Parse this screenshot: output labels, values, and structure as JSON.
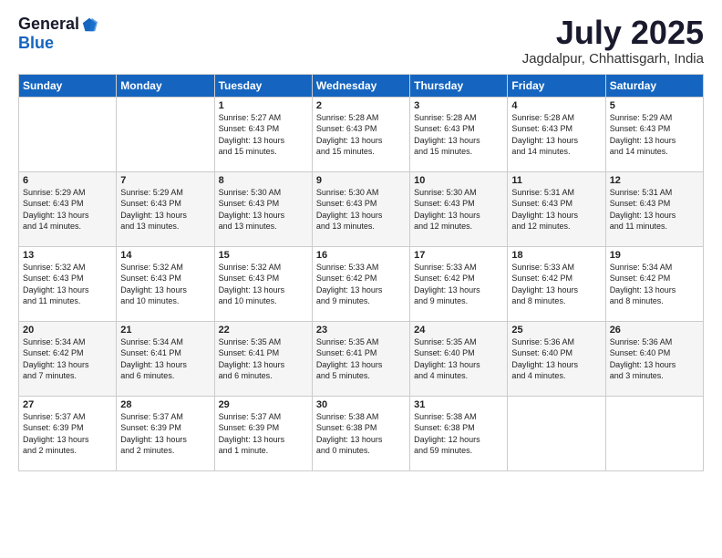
{
  "logo": {
    "general": "General",
    "blue": "Blue"
  },
  "title": "July 2025",
  "location": "Jagdalpur, Chhattisgarh, India",
  "days_of_week": [
    "Sunday",
    "Monday",
    "Tuesday",
    "Wednesday",
    "Thursday",
    "Friday",
    "Saturday"
  ],
  "weeks": [
    [
      {
        "day": "",
        "info": ""
      },
      {
        "day": "",
        "info": ""
      },
      {
        "day": "1",
        "info": "Sunrise: 5:27 AM\nSunset: 6:43 PM\nDaylight: 13 hours\nand 15 minutes."
      },
      {
        "day": "2",
        "info": "Sunrise: 5:28 AM\nSunset: 6:43 PM\nDaylight: 13 hours\nand 15 minutes."
      },
      {
        "day": "3",
        "info": "Sunrise: 5:28 AM\nSunset: 6:43 PM\nDaylight: 13 hours\nand 15 minutes."
      },
      {
        "day": "4",
        "info": "Sunrise: 5:28 AM\nSunset: 6:43 PM\nDaylight: 13 hours\nand 14 minutes."
      },
      {
        "day": "5",
        "info": "Sunrise: 5:29 AM\nSunset: 6:43 PM\nDaylight: 13 hours\nand 14 minutes."
      }
    ],
    [
      {
        "day": "6",
        "info": "Sunrise: 5:29 AM\nSunset: 6:43 PM\nDaylight: 13 hours\nand 14 minutes."
      },
      {
        "day": "7",
        "info": "Sunrise: 5:29 AM\nSunset: 6:43 PM\nDaylight: 13 hours\nand 13 minutes."
      },
      {
        "day": "8",
        "info": "Sunrise: 5:30 AM\nSunset: 6:43 PM\nDaylight: 13 hours\nand 13 minutes."
      },
      {
        "day": "9",
        "info": "Sunrise: 5:30 AM\nSunset: 6:43 PM\nDaylight: 13 hours\nand 13 minutes."
      },
      {
        "day": "10",
        "info": "Sunrise: 5:30 AM\nSunset: 6:43 PM\nDaylight: 13 hours\nand 12 minutes."
      },
      {
        "day": "11",
        "info": "Sunrise: 5:31 AM\nSunset: 6:43 PM\nDaylight: 13 hours\nand 12 minutes."
      },
      {
        "day": "12",
        "info": "Sunrise: 5:31 AM\nSunset: 6:43 PM\nDaylight: 13 hours\nand 11 minutes."
      }
    ],
    [
      {
        "day": "13",
        "info": "Sunrise: 5:32 AM\nSunset: 6:43 PM\nDaylight: 13 hours\nand 11 minutes."
      },
      {
        "day": "14",
        "info": "Sunrise: 5:32 AM\nSunset: 6:43 PM\nDaylight: 13 hours\nand 10 minutes."
      },
      {
        "day": "15",
        "info": "Sunrise: 5:32 AM\nSunset: 6:43 PM\nDaylight: 13 hours\nand 10 minutes."
      },
      {
        "day": "16",
        "info": "Sunrise: 5:33 AM\nSunset: 6:42 PM\nDaylight: 13 hours\nand 9 minutes."
      },
      {
        "day": "17",
        "info": "Sunrise: 5:33 AM\nSunset: 6:42 PM\nDaylight: 13 hours\nand 9 minutes."
      },
      {
        "day": "18",
        "info": "Sunrise: 5:33 AM\nSunset: 6:42 PM\nDaylight: 13 hours\nand 8 minutes."
      },
      {
        "day": "19",
        "info": "Sunrise: 5:34 AM\nSunset: 6:42 PM\nDaylight: 13 hours\nand 8 minutes."
      }
    ],
    [
      {
        "day": "20",
        "info": "Sunrise: 5:34 AM\nSunset: 6:42 PM\nDaylight: 13 hours\nand 7 minutes."
      },
      {
        "day": "21",
        "info": "Sunrise: 5:34 AM\nSunset: 6:41 PM\nDaylight: 13 hours\nand 6 minutes."
      },
      {
        "day": "22",
        "info": "Sunrise: 5:35 AM\nSunset: 6:41 PM\nDaylight: 13 hours\nand 6 minutes."
      },
      {
        "day": "23",
        "info": "Sunrise: 5:35 AM\nSunset: 6:41 PM\nDaylight: 13 hours\nand 5 minutes."
      },
      {
        "day": "24",
        "info": "Sunrise: 5:35 AM\nSunset: 6:40 PM\nDaylight: 13 hours\nand 4 minutes."
      },
      {
        "day": "25",
        "info": "Sunrise: 5:36 AM\nSunset: 6:40 PM\nDaylight: 13 hours\nand 4 minutes."
      },
      {
        "day": "26",
        "info": "Sunrise: 5:36 AM\nSunset: 6:40 PM\nDaylight: 13 hours\nand 3 minutes."
      }
    ],
    [
      {
        "day": "27",
        "info": "Sunrise: 5:37 AM\nSunset: 6:39 PM\nDaylight: 13 hours\nand 2 minutes."
      },
      {
        "day": "28",
        "info": "Sunrise: 5:37 AM\nSunset: 6:39 PM\nDaylight: 13 hours\nand 2 minutes."
      },
      {
        "day": "29",
        "info": "Sunrise: 5:37 AM\nSunset: 6:39 PM\nDaylight: 13 hours\nand 1 minute."
      },
      {
        "day": "30",
        "info": "Sunrise: 5:38 AM\nSunset: 6:38 PM\nDaylight: 13 hours\nand 0 minutes."
      },
      {
        "day": "31",
        "info": "Sunrise: 5:38 AM\nSunset: 6:38 PM\nDaylight: 12 hours\nand 59 minutes."
      },
      {
        "day": "",
        "info": ""
      },
      {
        "day": "",
        "info": ""
      }
    ]
  ]
}
